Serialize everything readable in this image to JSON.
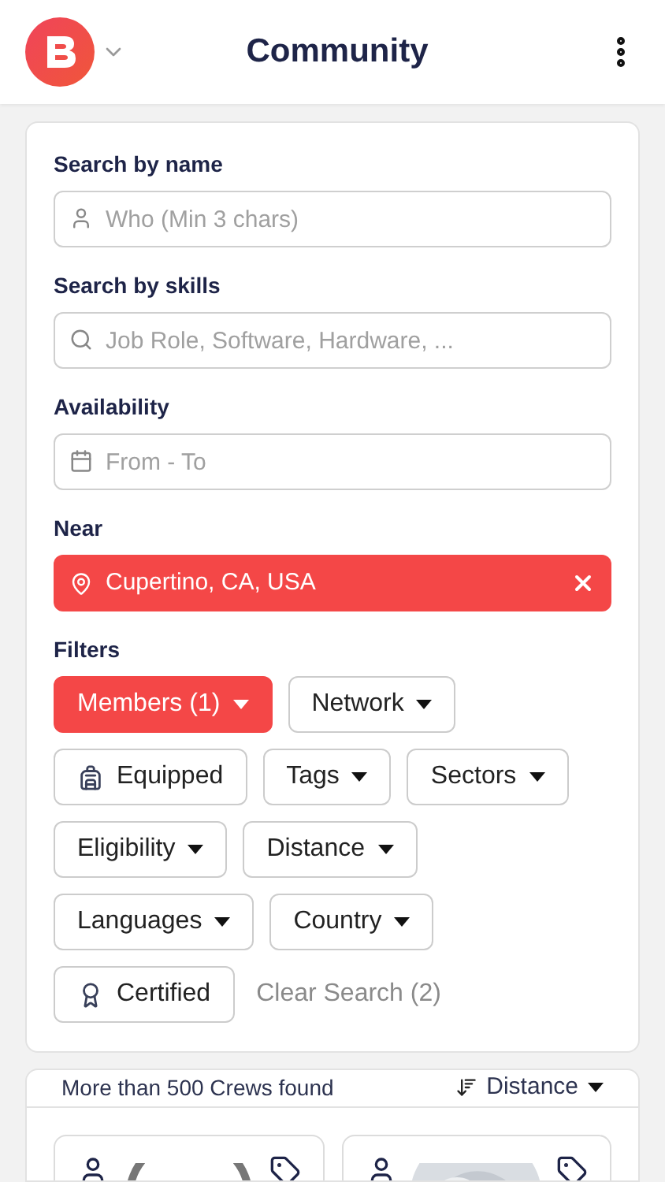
{
  "header": {
    "title": "Community"
  },
  "search": {
    "name_label": "Search by name",
    "name_placeholder": "Who (Min 3 chars)",
    "skills_label": "Search by skills",
    "skills_placeholder": "Job Role, Software, Hardware, ...",
    "availability_label": "Availability",
    "availability_placeholder": "From - To",
    "near_label": "Near",
    "near_value": "Cupertino, CA, USA",
    "filters_label": "Filters"
  },
  "filter_rows": [
    [
      {
        "label": "Members (1)",
        "kind": "dropdown",
        "selected": true
      },
      {
        "label": "Network",
        "kind": "dropdown",
        "selected": false
      }
    ],
    [
      {
        "label": "Equipped",
        "kind": "equipped",
        "selected": false
      },
      {
        "label": "Tags",
        "kind": "dropdown",
        "selected": false
      },
      {
        "label": "Sectors",
        "kind": "dropdown",
        "selected": false
      }
    ],
    [
      {
        "label": "Eligibility",
        "kind": "dropdown",
        "selected": false
      },
      {
        "label": "Distance",
        "kind": "dropdown",
        "selected": false
      }
    ],
    [
      {
        "label": "Languages",
        "kind": "dropdown",
        "selected": false
      },
      {
        "label": "Country",
        "kind": "dropdown",
        "selected": false
      }
    ],
    [
      {
        "label": "Certified",
        "kind": "certified",
        "selected": false
      },
      {
        "label": "Clear Search (2)",
        "kind": "link"
      }
    ]
  ],
  "results": {
    "count": "More than 500 Crews found",
    "sort": "Distance",
    "cards": [
      {
        "kind": "ring"
      },
      {
        "kind": "picture"
      }
    ]
  }
}
